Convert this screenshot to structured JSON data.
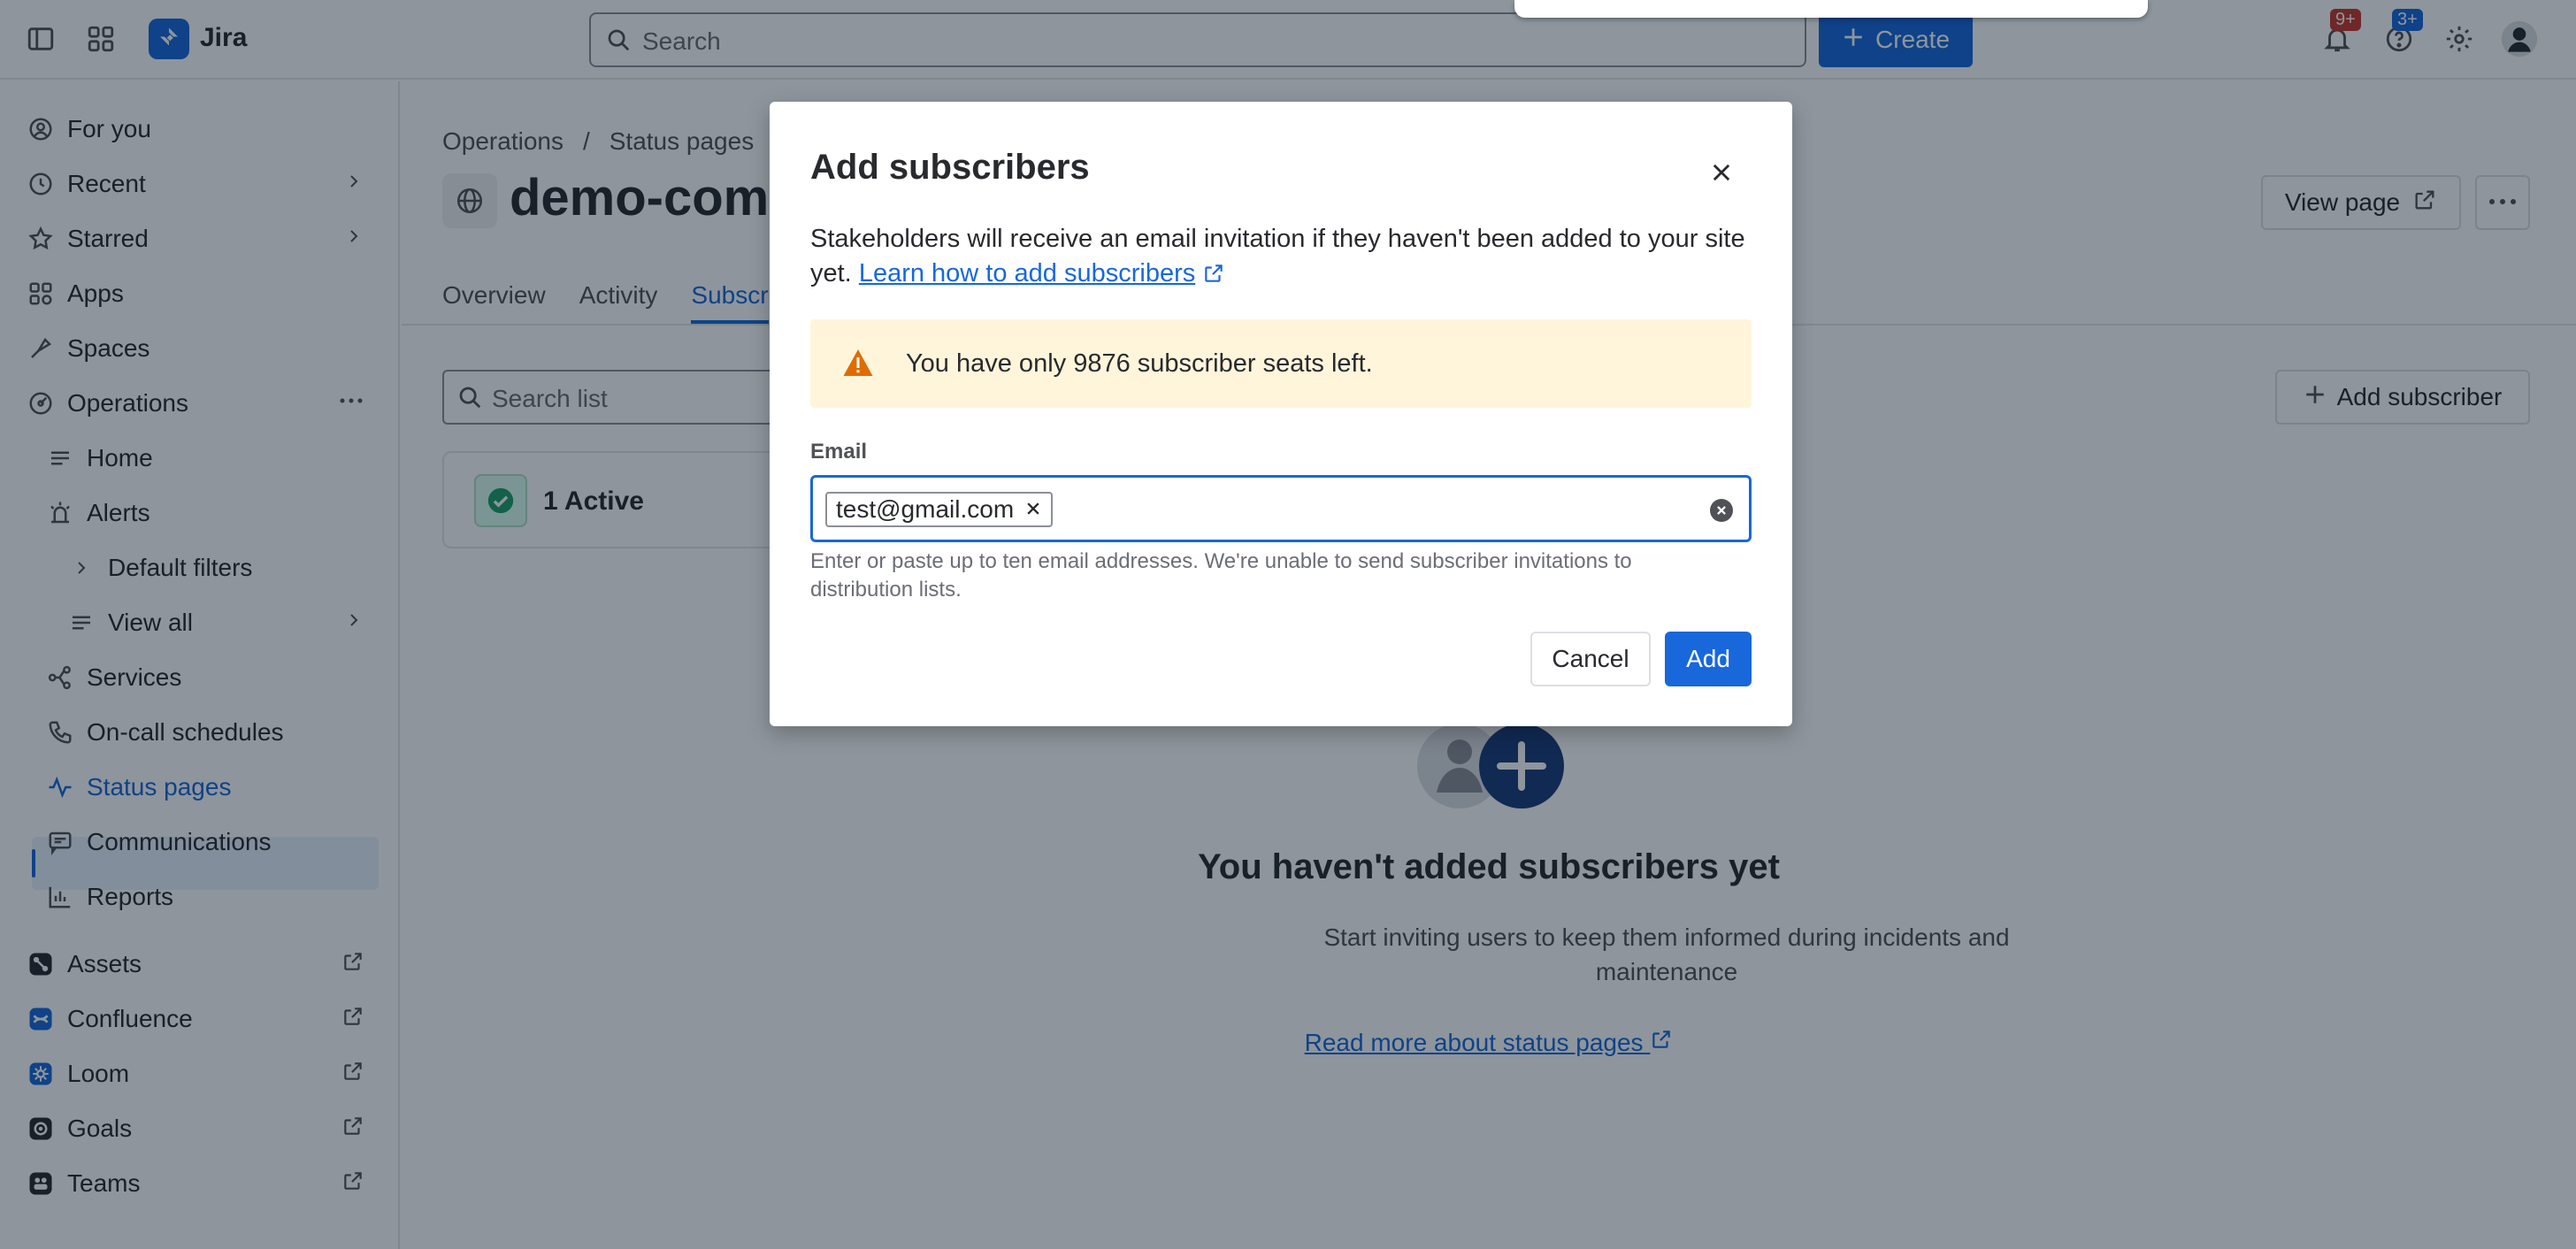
{
  "topbar": {
    "app_name": "Jira",
    "search_placeholder": "Search",
    "create_label": "Create",
    "notifications_badge": "9+",
    "help_badge": "3+"
  },
  "sidebar": {
    "items": [
      {
        "label": "For you",
        "icon": "user-circle-icon"
      },
      {
        "label": "Recent",
        "icon": "clock-icon"
      },
      {
        "label": "Starred",
        "icon": "star-icon"
      },
      {
        "label": "Apps",
        "icon": "apps-icon"
      },
      {
        "label": "Spaces",
        "icon": "spaces-icon"
      },
      {
        "label": "Operations",
        "icon": "operations-icon"
      },
      {
        "label": "Home",
        "icon": "home-lines-icon"
      },
      {
        "label": "Alerts",
        "icon": "alert-icon"
      },
      {
        "label": "Default filters",
        "icon": "chevron-right-icon"
      },
      {
        "label": "View all",
        "icon": "list-icon"
      },
      {
        "label": "Services",
        "icon": "services-icon"
      },
      {
        "label": "On-call schedules",
        "icon": "phone-icon"
      },
      {
        "label": "Status pages",
        "icon": "pulse-icon"
      },
      {
        "label": "Communications",
        "icon": "message-icon"
      },
      {
        "label": "Reports",
        "icon": "chart-icon"
      },
      {
        "label": "Assets",
        "icon": "assets-icon"
      },
      {
        "label": "Confluence",
        "icon": "confluence-icon"
      },
      {
        "label": "Loom",
        "icon": "loom-icon"
      },
      {
        "label": "Goals",
        "icon": "goals-icon"
      },
      {
        "label": "Teams",
        "icon": "teams-icon"
      }
    ]
  },
  "main": {
    "breadcrumb": [
      "Operations",
      "/",
      "Status pages"
    ],
    "title": "demo-comr",
    "view_page_label": "View page",
    "tabs": [
      "Overview",
      "Activity",
      "Subscr"
    ],
    "search_placeholder": "Search list",
    "add_subscriber_label": "Add subscriber",
    "active_count_label": "1 Active",
    "empty_title": "You haven't added subscribers yet",
    "empty_desc": "Start inviting users to keep them informed during incidents and maintenance",
    "read_more": "Read more about status pages"
  },
  "modal": {
    "title": "Add subscribers",
    "desc_prefix": "Stakeholders will receive an email invitation if they haven't been added to your site yet.",
    "desc_link": "Learn how to add subscribers",
    "warning": "You have only 9876 subscriber seats left.",
    "email_label": "Email",
    "email_chip": "test@gmail.com",
    "helper": "Enter or paste up to ten email addresses. We're unable to send subscriber invitations to distribution lists.",
    "cancel_label": "Cancel",
    "add_label": "Add"
  },
  "colors": {
    "brand": "#1868db",
    "warning_bg": "#fff5db",
    "warning_icon": "#e06c00",
    "success_bg": "#dcfff1"
  }
}
